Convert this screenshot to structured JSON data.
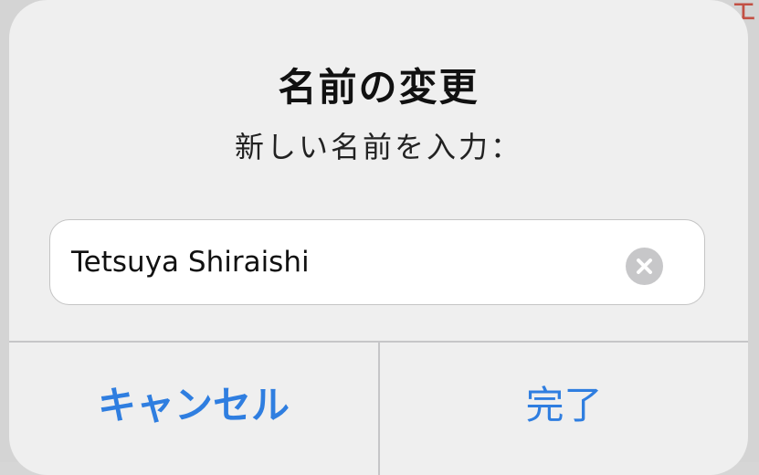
{
  "background": {
    "partial_glyph": "ェ"
  },
  "alert": {
    "title": "名前の変更",
    "message": "新しい名前を入力：",
    "field": {
      "value": "Tetsuya Shiraishi",
      "clear_icon": "clear-circle-x"
    },
    "buttons": {
      "cancel_label": "キャンセル",
      "done_label": "完了"
    }
  },
  "colors": {
    "accent": "#2f7ee0",
    "alert_background": "#efefef",
    "field_background": "#ffffff",
    "clear_icon": "#c7c7c9"
  }
}
